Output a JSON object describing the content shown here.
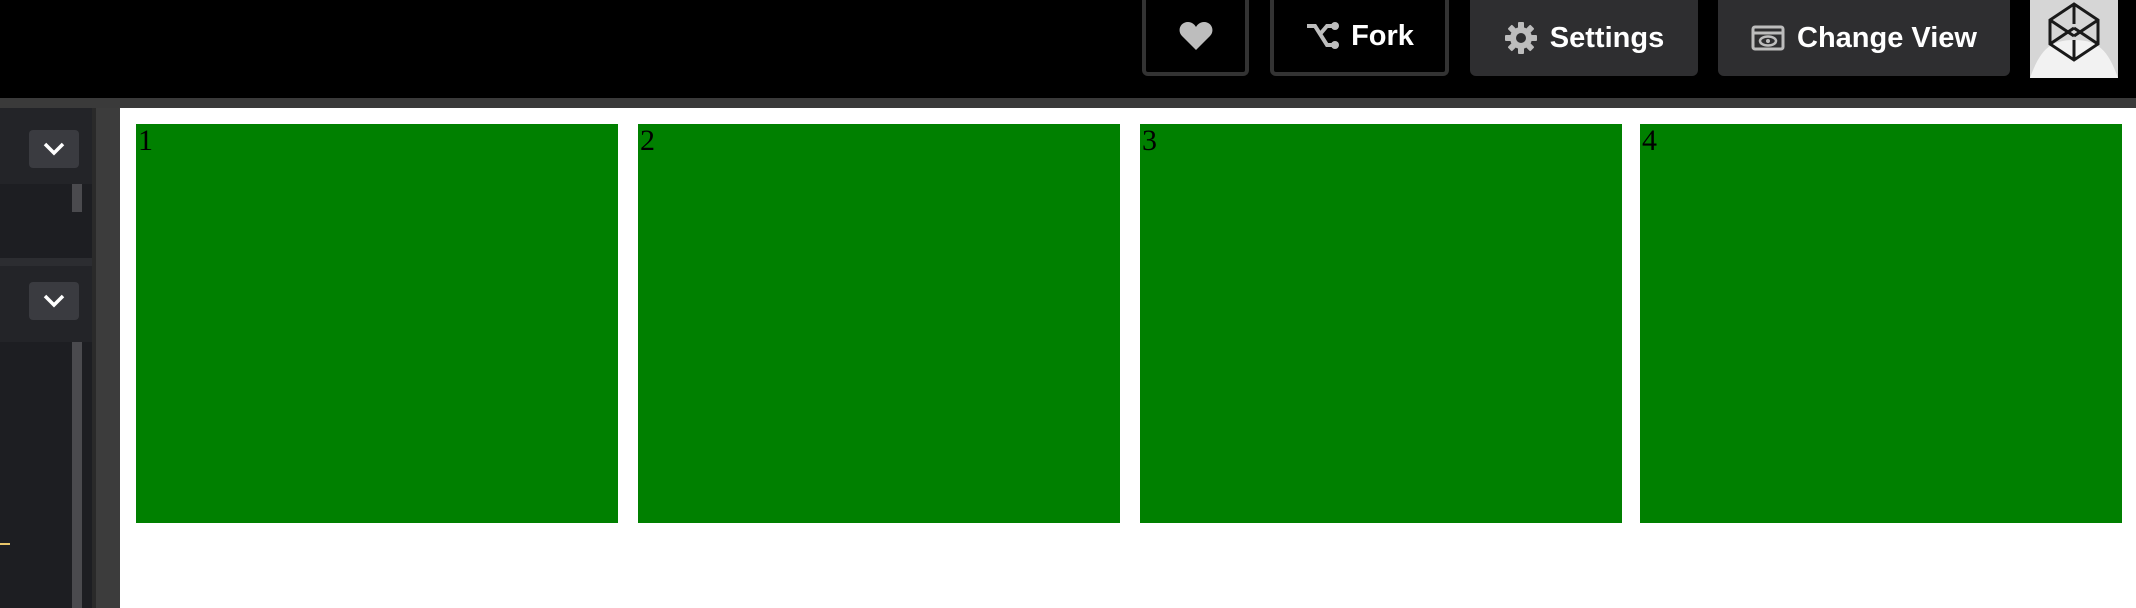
{
  "header": {
    "like_label": "",
    "fork_label": "Fork",
    "settings_label": "Settings",
    "change_view_label": "Change View"
  },
  "icons": {
    "like": "heart-icon",
    "fork": "fork-icon",
    "settings": "gear-icon",
    "change_view": "eye-icon",
    "collapse": "chevron-down-icon",
    "avatar": "codepen-logo"
  },
  "preview": {
    "boxes": [
      {
        "label": "1"
      },
      {
        "label": "2"
      },
      {
        "label": "3"
      },
      {
        "label": "4"
      }
    ]
  },
  "colors": {
    "topbar": "#000000",
    "button_bg": "#2e2e30",
    "box_green": "#008000",
    "editor_bg": "#1d1e22"
  }
}
